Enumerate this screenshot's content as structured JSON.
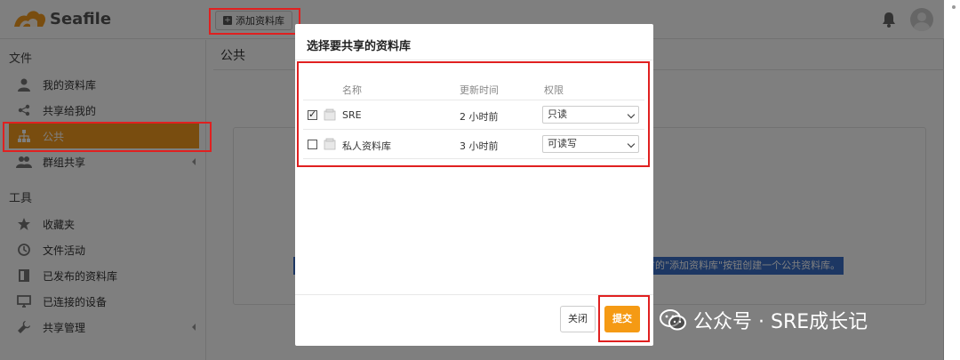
{
  "app": {
    "logo_text": "Seafile",
    "add_library_button": "添加资料库",
    "main_title": "公共",
    "empty_tip": "方的\"添加资料库\"按钮创建一个公共资料库。"
  },
  "sidebar": {
    "section_files": "文件",
    "section_tools": "工具",
    "items": [
      {
        "label": "我的资料库",
        "icon": "user-icon"
      },
      {
        "label": "共享给我的",
        "icon": "share-icon"
      },
      {
        "label": "公共",
        "icon": "org-chart-icon",
        "active": true
      },
      {
        "label": "群组共享",
        "icon": "group-icon"
      },
      {
        "label": "收藏夹",
        "icon": "star-icon"
      },
      {
        "label": "文件活动",
        "icon": "clock-icon"
      },
      {
        "label": "已发布的资料库",
        "icon": "book-icon"
      },
      {
        "label": "已连接的设备",
        "icon": "monitor-icon"
      },
      {
        "label": "共享管理",
        "icon": "wrench-icon"
      }
    ]
  },
  "modal": {
    "title": "选择要共享的资料库",
    "columns": [
      "名称",
      "更新时间",
      "权限"
    ],
    "rows": [
      {
        "name": "SRE",
        "time": "2 小时前",
        "permission": "只读",
        "checked": true
      },
      {
        "name": "私人资料库",
        "time": "3 小时前",
        "permission": "可读写",
        "checked": false
      }
    ],
    "close_label": "关闭",
    "submit_label": "提交"
  },
  "watermark": {
    "text": "公众号 · SRE成长记"
  },
  "colors": {
    "accent": "#f29a1e",
    "annotation": "#e02020",
    "tip_bg": "#3a6fc7"
  }
}
